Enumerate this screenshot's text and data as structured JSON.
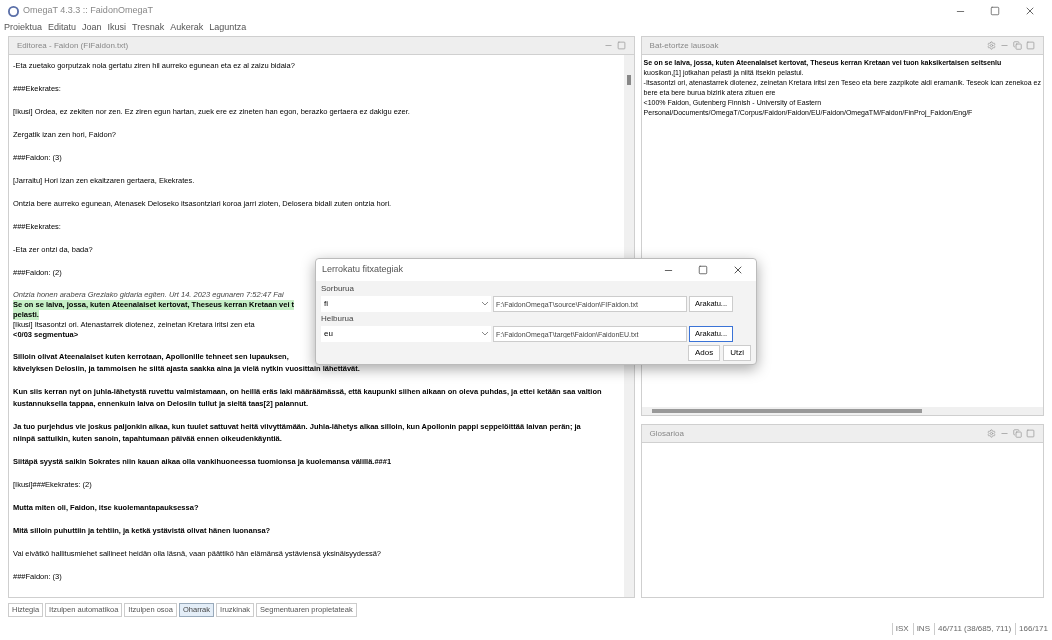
{
  "window": {
    "title": "OmegaT 4.3.3 :: FaidonOmegaT"
  },
  "menu": [
    "Proiektua",
    "Editatu",
    "Joan",
    "Ikusi",
    "Tresnak",
    "Aukerak",
    "Laguntza"
  ],
  "editor": {
    "title": "Editorea - Faidon (FIFaidon.txt)",
    "segments": [
      {
        "kind": "normal",
        "lines": [
          "-Eta zuetako gorputzak nola gertatu ziren hil aurreko egunean eta ez al zaizu bidaia?"
        ]
      },
      {
        "kind": "normal",
        "lines": [
          "###Ekekrates:"
        ]
      },
      {
        "kind": "normal",
        "lines": [
          "[Ikusi] Ordea, ez zekiten nor zen. Ez ziren egun hartan, zuek ere ez zineten han egon, berazko gertaera ez dakigu ezer."
        ]
      },
      {
        "kind": "normal",
        "lines": [
          "Zergatik izan zen hori, Faidon?"
        ]
      },
      {
        "kind": "normal",
        "lines": [
          "###Faidon: (3)"
        ]
      },
      {
        "kind": "normal",
        "lines": [
          "[Jarraitu] Hori izan zen ekaitzaren gertaera, Ekekrates."
        ]
      },
      {
        "kind": "normal",
        "lines": [
          "Ontzia bere aurreko egunean, Atenasek Deloseko itsasontziari koroa jarri zioten, Delosera bidali zuten ontzia hori."
        ]
      },
      {
        "kind": "normal",
        "lines": [
          "###Ekekrates:"
        ]
      },
      {
        "kind": "normal",
        "lines": [
          "-Eta zer ontzi da, bada?"
        ]
      },
      {
        "kind": "normal",
        "lines": [
          "###Faidon: (2)"
        ]
      },
      {
        "kind": "active",
        "lines": [
          {
            "kind": "note",
            "text": "Ontzia honen arabera Greziako gidaria egiten. Urt 14. 2023 egunaren 7:52:47 Fai"
          },
          {
            "kind": "source",
            "text": "Se on se laiva, jossa, kuten Ateenalaiset kertovat, Theseus kerran Kretaan vei t"
          },
          {
            "kind": "source",
            "text": "pelasti."
          },
          {
            "kind": "target",
            "text": "[Ikusi] Itsasontzi ori. Atenastarrek diotenez, zeinetan Kretara iritsi zen eta"
          },
          {
            "kind": "tag",
            "text": "<0/03 segmentua>"
          }
        ]
      },
      {
        "kind": "bold",
        "lines": [
          "Silloin olivat Ateenalaiset kuten kerrotaan, Apollonille tehneet sen lupauksen,",
          "kävelyksen Delosiin, ja tammoisen he siitä ajasta saakka aina ja vielä nytkin vuosittain lähettävät."
        ]
      },
      {
        "kind": "bold",
        "lines": [
          "Kun siis kerran nyt on juhla-lähetystä ruvettu valmistamaan, on heillä eräs laki määräämässä, että kaupunki siihen aikaan on oleva puhdas, ja ettei ketään saa valtion",
          "kustannuksella tappaa, ennenkuin laiva on Delosiin tullut ja sieltä taas[2] palannut."
        ]
      },
      {
        "kind": "bold",
        "lines": [
          "Ja tuo purjehdus vie joskus paljonkin aikaa, kun tuulet sattuvat heitä viivyttämään. Juhla-lähetys alkaa silloin, kun Apollonin pappi seppelöittää laivan perän; ja",
          "niinpä sattuikin, kuten sanoin, tapahtumaan päivää ennen oikeudenkäyntiä."
        ]
      },
      {
        "kind": "bold",
        "lines": [
          "Siitäpä syystä saikin Sokrates niin kauan aikaa olla vankihuoneessa tuomionsa ja kuolemansa välillä.###1"
        ]
      },
      {
        "kind": "normal",
        "lines": [
          "[Ikusi]###Ekekrates: (2)"
        ]
      },
      {
        "kind": "bold",
        "lines": [
          "Mutta miten oli, Faidon, itse kuolemantapauksessa?"
        ]
      },
      {
        "kind": "bold",
        "lines": [
          "Mitä silloin puhuttiin ja tehtiin, ja ketkä ystävistä olivat hänen luonansa?"
        ]
      },
      {
        "kind": "normal",
        "lines": [
          "Vai eivätkö hallitusmiehet sallineet heidän olla läsnä, vaan päättikö hän elämänsä ystäviensä yksinäisyydessä?"
        ]
      },
      {
        "kind": "normal",
        "lines": [
          "###Faidon: (3)"
        ]
      }
    ]
  },
  "matches": {
    "title": "Bat-etortze lausoak",
    "lines": [
      {
        "kind": "bold",
        "text": "Se on se laiva, jossa, kuten Ateenalaiset kertovat, Theseus kerran Kretaan vei tuon kaksikertaisen seitsenlu"
      },
      {
        "kind": "normal",
        "text": "kuosikon,[1] jotkahan pelasti ja niitä itsekin pelastui."
      },
      {
        "kind": "normal",
        "text": "-Itsasontzi ori, atenastarrek diotenez, zeinetan Kretara iritsi zen Teseo eta bere zazpikote aldi eramanik. Teseok ican zenekoa ez"
      },
      {
        "kind": "normal",
        "text": "bere eta bere burua bizirik atera zituen ere"
      },
      {
        "kind": "normal",
        "text": "<100% Faidon, Gutenberg Finnish - University of Eastern"
      },
      {
        "kind": "normal",
        "text": "Personal/Documents/OmegaT/Corpus/Faidon/Faidon/EU/Faidon/OmegaTM/Faidon/FinProj_Faidon/Eng/F"
      }
    ]
  },
  "glossary": {
    "title": "Glosarioa"
  },
  "dialog": {
    "title": "Lerrokatu fitxategiak",
    "rows": [
      {
        "label": "Sorburua",
        "language": "fi",
        "path": "F:\\FaidonOmegaT\\source\\Faidon\\FIFaidon.txt",
        "button": "Arakatu...",
        "focused": false
      },
      {
        "label": "Helburua",
        "language": "eu",
        "path": "F:\\FaidonOmegaT\\target\\Faidon\\FaidonEU.txt",
        "button": "Arakatu...",
        "focused": true
      }
    ],
    "buttons": [
      "Ados",
      "Utzi"
    ]
  },
  "tabs": [
    {
      "label": "Hiztegia",
      "selected": false
    },
    {
      "label": "Itzulpen automatikoa",
      "selected": false
    },
    {
      "label": "Itzulpen osoa",
      "selected": false
    },
    {
      "label": "Oharrak",
      "selected": true
    },
    {
      "label": "Iruzkinak",
      "selected": false
    },
    {
      "label": "Segmentuaren propietateak",
      "selected": false
    }
  ],
  "status_bar": [
    "ISX",
    "INS",
    "46/711 (38/685, 711)",
    "166/171"
  ]
}
